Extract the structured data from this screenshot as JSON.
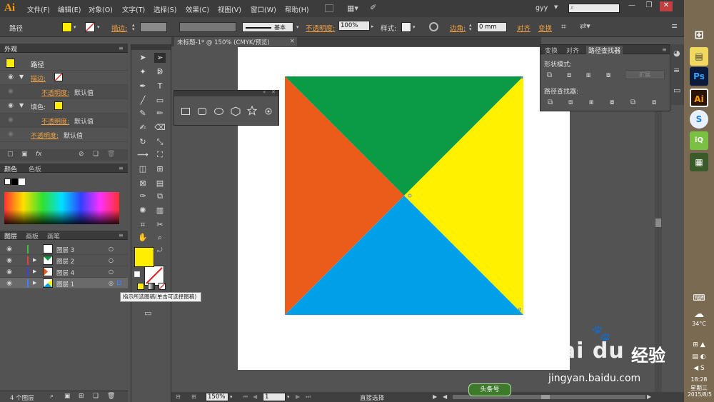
{
  "app": {
    "logo": "Ai"
  },
  "menubar": {
    "items": [
      "文件(F)",
      "编辑(E)",
      "对象(O)",
      "文字(T)",
      "选择(S)",
      "效果(C)",
      "视图(V)",
      "窗口(W)",
      "帮助(H)"
    ],
    "user": "gyy"
  },
  "control_bar": {
    "selection_label": "路径",
    "fill_color": "#ffee00",
    "stroke_label": "描边:",
    "stroke_style_label": "基本",
    "opacity_label": "不透明度:",
    "opacity_value": "100%",
    "style_label": "样式:",
    "corner_label": "边角:",
    "corner_value": "0 mm",
    "align_label": "对齐",
    "transform_label": "变换"
  },
  "appearance_panel": {
    "tab": "外观",
    "title": "路径",
    "rows": [
      {
        "label": "描边:",
        "kind": "stroke"
      },
      {
        "label": "不透明度:",
        "value": "默认值"
      },
      {
        "label": "填色:",
        "kind": "fill"
      },
      {
        "label": "不透明度:",
        "value": "默认值"
      },
      {
        "label": "不透明度:",
        "value": "默认值"
      }
    ]
  },
  "color_panel": {
    "tabs": [
      "颜色",
      "色板"
    ]
  },
  "layers_panel": {
    "tabs": [
      "图层",
      "画板",
      "画笔"
    ],
    "layers": [
      {
        "name": "图层 3",
        "color": "#3fbf3f"
      },
      {
        "name": "图层 2",
        "color": "#e04040"
      },
      {
        "name": "图层 4",
        "color": "#4040e0"
      },
      {
        "name": "图层 1",
        "color": "#4080ff"
      }
    ],
    "footer_count": "4 个图层"
  },
  "shapes_panel": {
    "shapes": [
      "rectangle",
      "rounded-rectangle",
      "ellipse",
      "polygon",
      "star",
      "flare"
    ]
  },
  "pathfinder_panel": {
    "tabs": [
      "变换",
      "对齐",
      "路径查找器"
    ],
    "shape_modes_label": "形状模式:",
    "expand_label": "扩展",
    "pathfinders_label": "路径查找器:"
  },
  "document": {
    "tab_title": "未标题-1* @ 150% (CMYK/预览)",
    "triangles": {
      "top": "#0b9a45",
      "right": "#fff100",
      "bottom": "#00a0e8",
      "left": "#eb5c1a"
    }
  },
  "status_bar": {
    "zoom": "150%",
    "page": "1",
    "tool": "直接选择"
  },
  "tooltip": "指示所选图稿(单击可选择图稿)",
  "watermark": {
    "logo": "Bai du",
    "brand": "经验",
    "url": "jingyan.baidu.com",
    "badge": "头条号"
  },
  "taskbar": {
    "temperature": "34°C",
    "time": "18:28",
    "weekday": "星期三",
    "date": "2015/8/5",
    "apps": [
      "Ps",
      "Ai"
    ]
  }
}
